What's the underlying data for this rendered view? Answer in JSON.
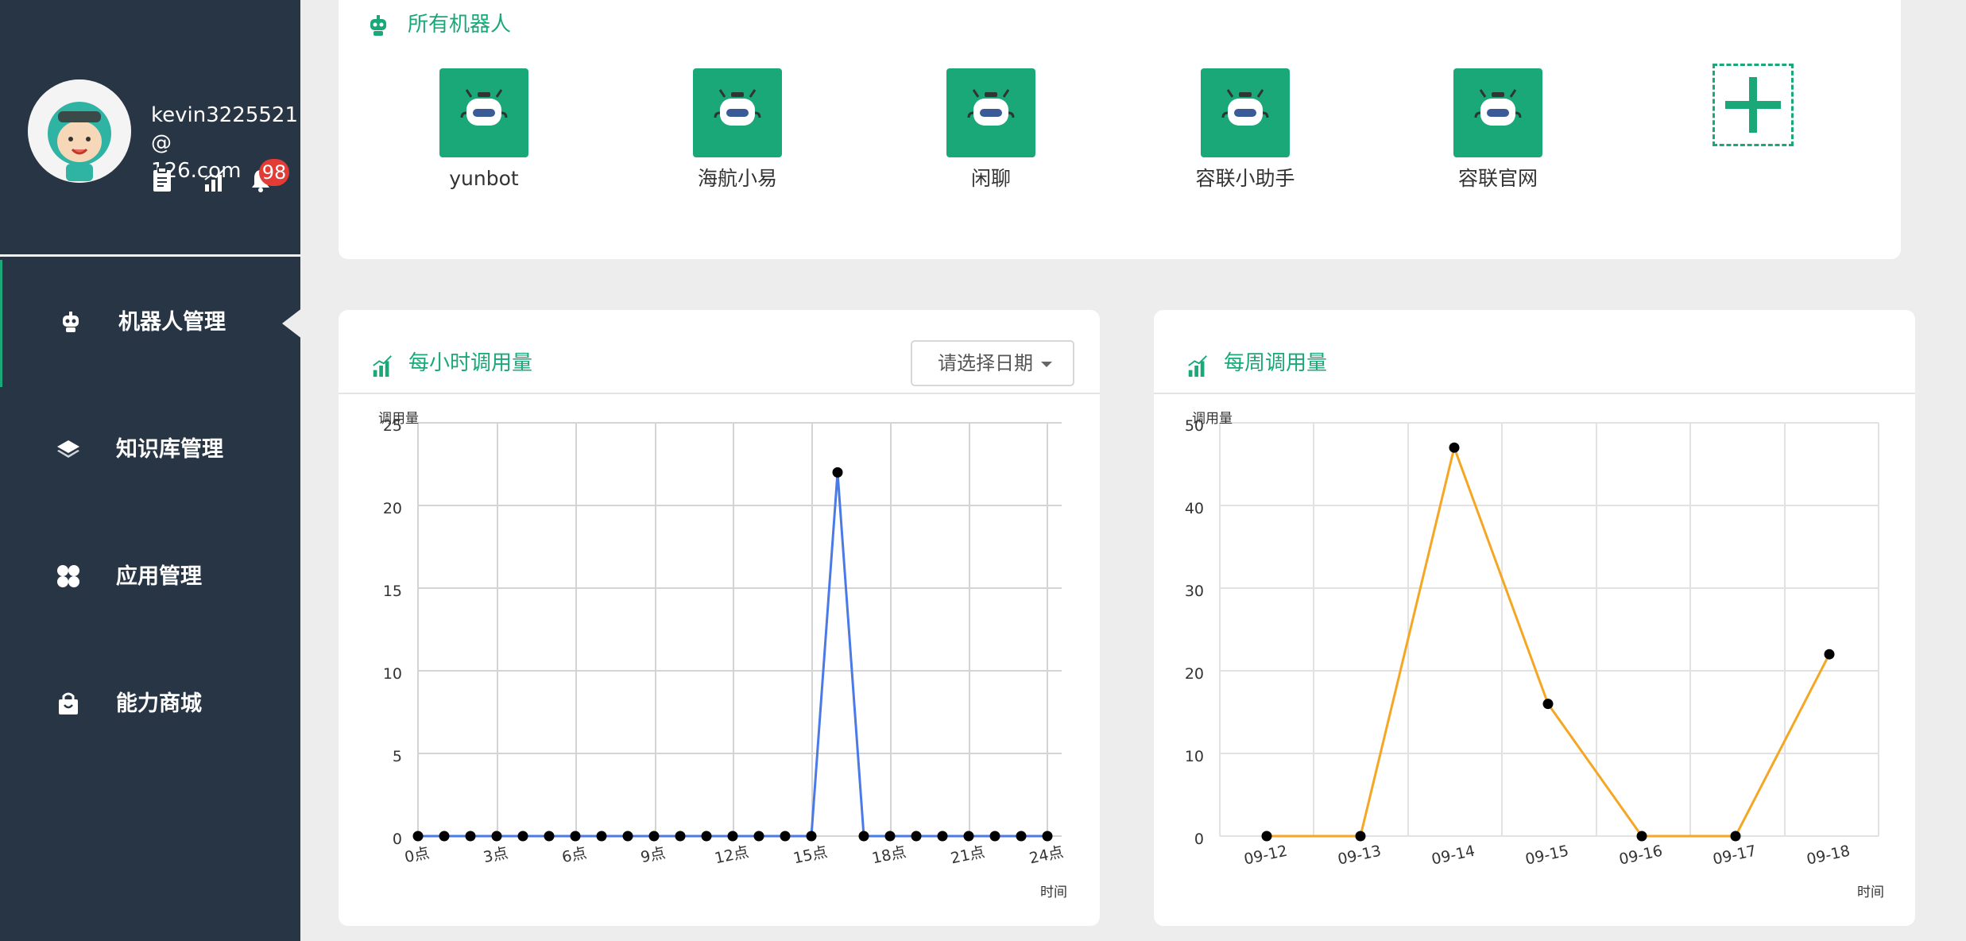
{
  "sidebar": {
    "profile": {
      "email_line1": "kevin3225521@",
      "email_line2": "126.com",
      "notification_count": "98",
      "icons": [
        "clipboard-icon",
        "stats-icon",
        "bell-icon"
      ]
    },
    "items": [
      {
        "label": "机器人管理",
        "icon": "robot-icon",
        "active": true
      },
      {
        "label": "知识库管理",
        "icon": "layers-icon",
        "active": false
      },
      {
        "label": "应用管理",
        "icon": "apps-icon",
        "active": false
      },
      {
        "label": "能力商城",
        "icon": "shop-icon",
        "active": false
      }
    ]
  },
  "robots": {
    "title": "所有机器人",
    "items": [
      "yunbot",
      "海航小易",
      "闲聊",
      "容联小助手",
      "容联官网"
    ],
    "add_icon": "plus-icon"
  },
  "hourly": {
    "title": "每小时调用量",
    "date_select": "请选择日期"
  },
  "weekly": {
    "title": "每周调用量"
  },
  "colors": {
    "accent": "#1aa879",
    "sidebar": "#283544",
    "hourly_line": "#4a7ae6",
    "weekly_line": "#f5a623",
    "badge": "#e33b36"
  },
  "chart_data": [
    {
      "type": "line",
      "ylabel": "调用量",
      "xlabel": "时间",
      "ylim": [
        0,
        25
      ],
      "yticks": [
        0,
        5,
        10,
        15,
        20,
        25
      ],
      "xtick_labels": [
        "0点",
        "3点",
        "6点",
        "9点",
        "12点",
        "15点",
        "18点",
        "21点",
        "24点"
      ],
      "x": [
        0,
        1,
        2,
        3,
        4,
        5,
        6,
        7,
        8,
        9,
        10,
        11,
        12,
        13,
        14,
        15,
        16,
        17,
        18,
        19,
        20,
        21,
        22,
        23,
        24
      ],
      "series": [
        {
          "values": [
            0,
            0,
            0,
            0,
            0,
            0,
            0,
            0,
            0,
            0,
            0,
            0,
            0,
            0,
            0,
            0,
            22,
            0,
            0,
            0,
            0,
            0,
            0,
            0,
            0
          ]
        }
      ],
      "grid": true
    },
    {
      "type": "line",
      "ylabel": "调用量",
      "xlabel": "时间",
      "ylim": [
        0,
        50
      ],
      "yticks": [
        0,
        10,
        20,
        30,
        40,
        50
      ],
      "categories": [
        "09-12",
        "09-13",
        "09-14",
        "09-15",
        "09-16",
        "09-17",
        "09-18"
      ],
      "series": [
        {
          "values": [
            0,
            0,
            47,
            16,
            0,
            0,
            22
          ]
        }
      ],
      "grid": true
    }
  ]
}
